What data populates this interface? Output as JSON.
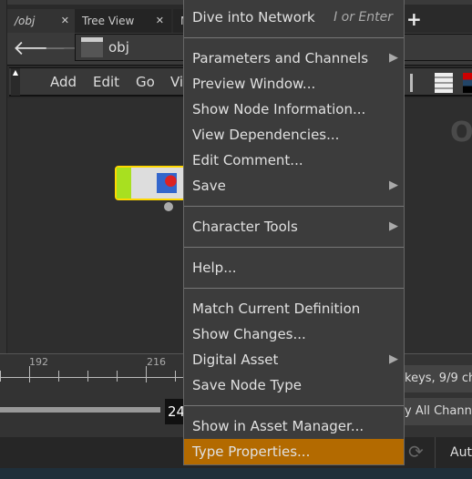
{
  "tabs": [
    {
      "label": "/obj"
    },
    {
      "label": "Tree View"
    },
    {
      "label": "M"
    }
  ],
  "path": {
    "label": "obj"
  },
  "menubar": {
    "items": [
      "Add",
      "Edit",
      "Go",
      "Vi"
    ]
  },
  "watermark": "O",
  "timeline": {
    "ticks": [
      "192",
      "216"
    ],
    "frame": "24"
  },
  "right_panel": {
    "keys_text": "keys, 9/9 ch",
    "channels_text": "y All Channe",
    "auto_label": "Aut"
  },
  "context_menu": {
    "items": [
      {
        "label": "Dive into Network",
        "shortcut": "I or Enter"
      },
      {
        "label": "Parameters and Channels",
        "submenu": true
      },
      {
        "label": "Preview Window..."
      },
      {
        "label": "Show Node Information..."
      },
      {
        "label": "View Dependencies..."
      },
      {
        "label": "Edit Comment..."
      },
      {
        "label": "Save",
        "submenu": true
      },
      {
        "label": "Character Tools",
        "submenu": true
      },
      {
        "label": "Help..."
      },
      {
        "label": "Match Current Definition"
      },
      {
        "label": "Show Changes..."
      },
      {
        "label": "Digital Asset",
        "submenu": true
      },
      {
        "label": "Save Node Type"
      },
      {
        "label": "Show in Asset Manager..."
      },
      {
        "label": "Type Properties...",
        "highlighted": true
      }
    ]
  },
  "colors": {
    "highlight": "#b36a00",
    "node_flag": "#a8e020",
    "node_border": "#ffd700"
  }
}
